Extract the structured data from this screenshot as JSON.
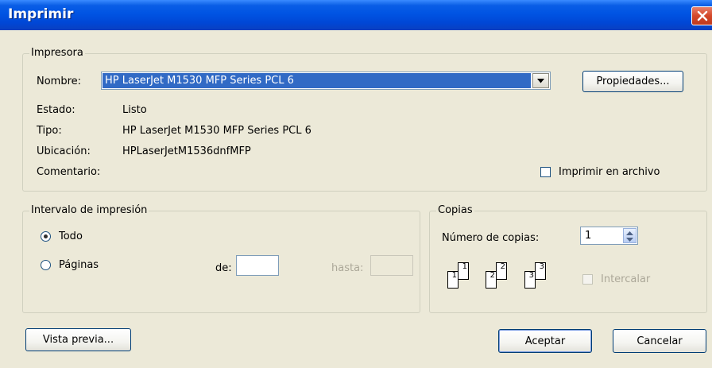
{
  "window": {
    "title": "Imprimir"
  },
  "printer_group": {
    "legend": "Impresora",
    "name_label": "Nombre:",
    "name_value": "HP LaserJet M1530 MFP Series PCL 6",
    "properties_button": "Propiedades...",
    "status_label": "Estado:",
    "status_value": "Listo",
    "type_label": "Tipo:",
    "type_value": "HP LaserJet M1530 MFP Series PCL 6",
    "location_label": "Ubicación:",
    "location_value": "HPLaserJetM1536dnfMFP",
    "comment_label": "Comentario:",
    "print_to_file_label": "Imprimir en archivo",
    "print_to_file_checked": false
  },
  "range_group": {
    "legend": "Intervalo de impresión",
    "all_label": "Todo",
    "all_selected": true,
    "pages_label": "Páginas",
    "from_label": "de:",
    "from_value": "",
    "to_label": "hasta:",
    "to_value": ""
  },
  "copies_group": {
    "legend": "Copias",
    "count_label": "Número de copias:",
    "count_value": "1",
    "collate_label": "Intercalar",
    "collate_checked": false,
    "collate_pages": [
      "1",
      "1",
      "2",
      "2",
      "3",
      "3"
    ]
  },
  "buttons": {
    "preview": "Vista previa...",
    "ok": "Aceptar",
    "cancel": "Cancelar"
  }
}
